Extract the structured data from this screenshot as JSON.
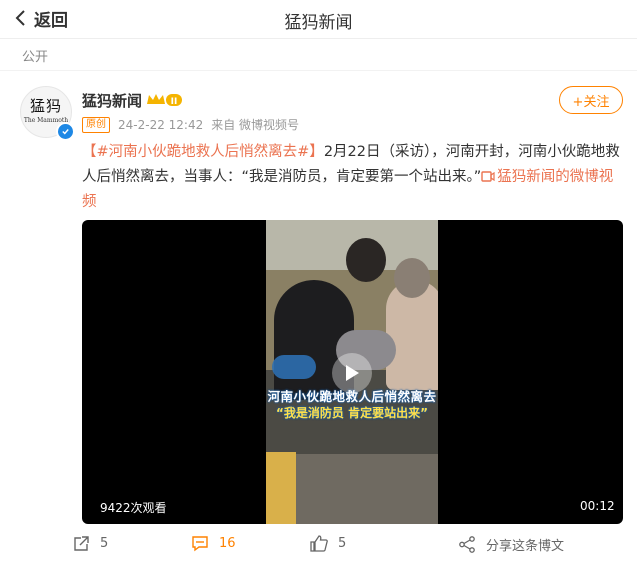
{
  "nav": {
    "back_label": "返回",
    "title": "猛犸新闻"
  },
  "post": {
    "visibility": "公开",
    "author": {
      "name": "猛犸新闻",
      "avatar_text": "猛犸",
      "avatar_subtext": "The Mammoth",
      "level_badge": "II"
    },
    "follow_label": "+关注",
    "meta": {
      "original_tag": "原创",
      "time": "24-2-22 12:42",
      "source": "来自 微博视频号"
    },
    "text": {
      "topic": "【#河南小伙跪地救人后悄然离去#】",
      "body": "2月22日（采访），河南开封，河南小伙跪地救人后悄然离去，当事人：“我是消防员，肯定要第一个站出来。”",
      "video_link": "猛犸新闻的微博视频"
    },
    "video": {
      "caption_line1": "河南小伙跪地救人后悄然离去",
      "caption_line2": "“我是消防员 肯定要站出来”",
      "views": "9422次观看",
      "duration": "00:12"
    },
    "actions": {
      "repost_count": "5",
      "comment_count": "16",
      "like_count": "5",
      "share_label": "分享这条博文"
    }
  },
  "colors": {
    "accent": "#ff8200",
    "topic": "#eb7350",
    "verified": "#1e88e5"
  }
}
